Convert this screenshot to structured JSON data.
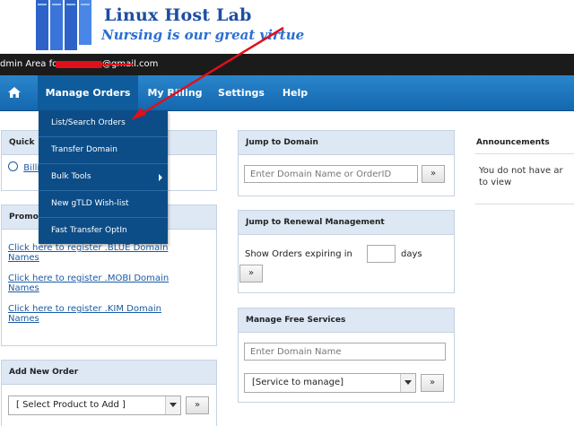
{
  "brand": {
    "title": "Linux Host Lab",
    "tagline": "Nursing is our great virtue"
  },
  "admin_bar": {
    "prefix": "dmin Area for ",
    "email_suffix": "@gmail.com"
  },
  "nav": {
    "home_icon": "home-icon",
    "items": [
      "Manage Orders",
      "My Billing",
      "Settings",
      "Help"
    ]
  },
  "dropdown": {
    "items": [
      "List/Search Orders",
      "Transfer Domain",
      "Bulk Tools",
      "New gTLD Wish-list",
      "Fast Transfer OptIn"
    ]
  },
  "quick_panel": {
    "title": "Quick",
    "link": "Billi"
  },
  "promo_panel": {
    "title": "Promo",
    "links": [
      "Click here to register .BLUE Domain Names",
      "Click here to register .MOBI Domain Names",
      "Click here to register .KIM Domain Names"
    ]
  },
  "add_order": {
    "title": "Add New Order",
    "select_value": "[ Select Product to Add ]",
    "go": "»"
  },
  "jump_domain": {
    "title": "Jump to Domain",
    "placeholder": "Enter Domain Name or OrderID",
    "go": "»"
  },
  "jump_renewal": {
    "title": "Jump to Renewal Management",
    "label_before": "Show Orders expiring in",
    "label_after": "days",
    "go": "»"
  },
  "free_services": {
    "title": "Manage Free Services",
    "placeholder": "Enter Domain Name",
    "select_value": "[Service to manage]",
    "go": "»"
  },
  "announcements": {
    "title": "Announcements",
    "text": "You do not have ar to view"
  },
  "colors": {
    "nav_blue": "#1a74bd",
    "dropdown_blue": "#0c4d87",
    "annotation_red": "#e0101a"
  }
}
